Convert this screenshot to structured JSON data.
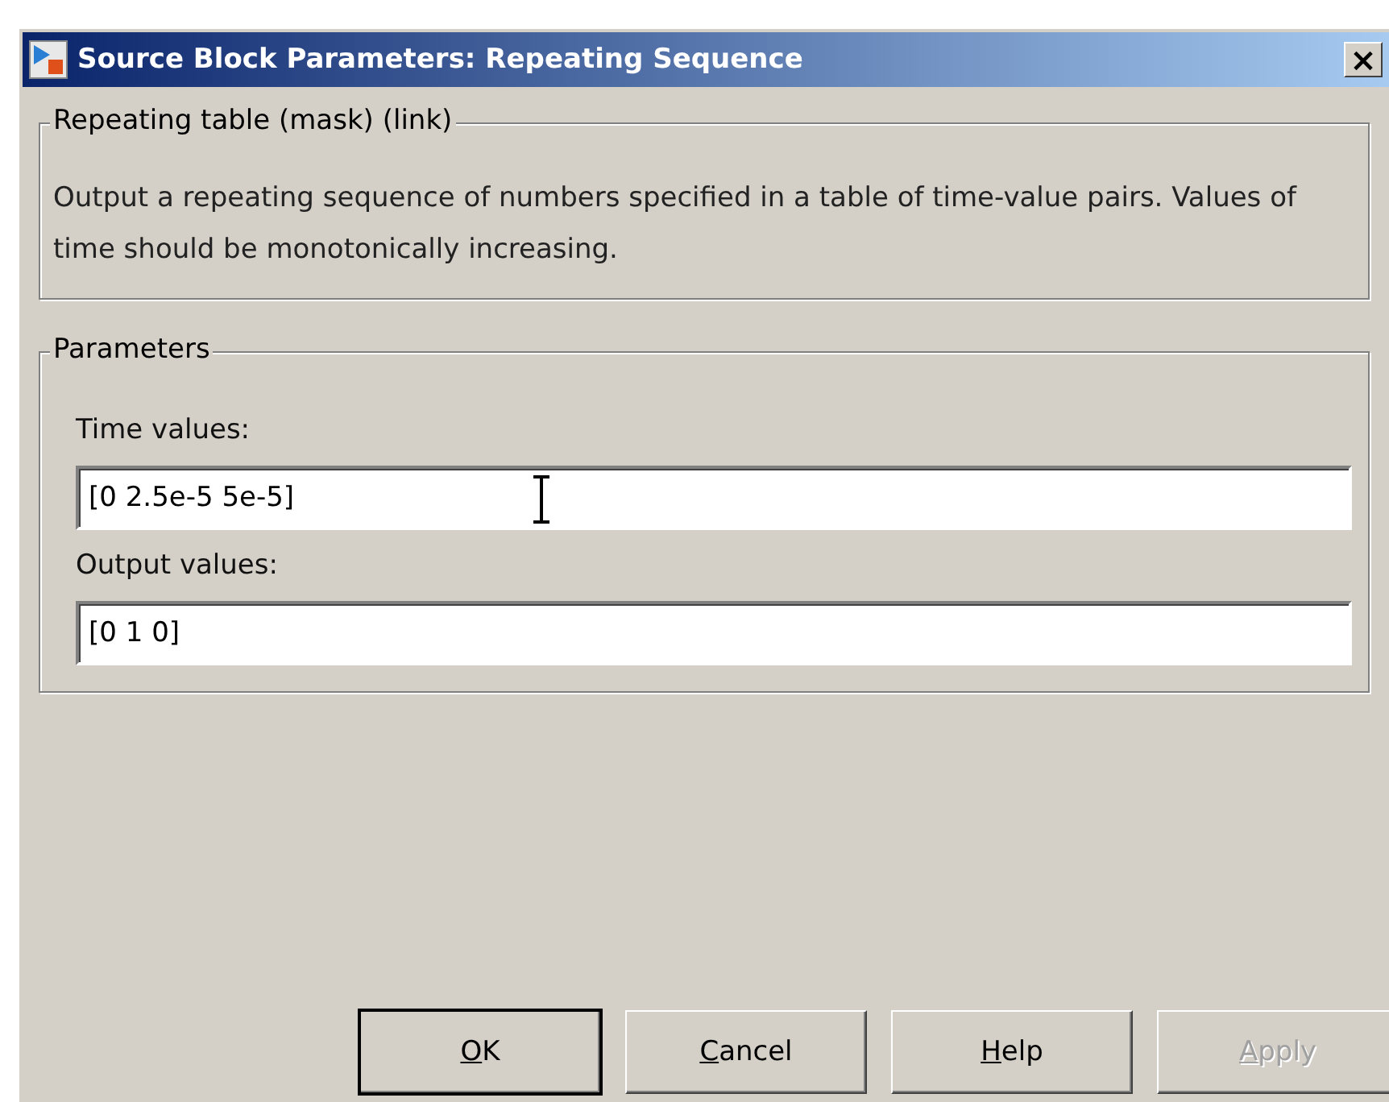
{
  "window": {
    "title": "Source Block Parameters: Repeating Sequence",
    "close": "×"
  },
  "description_group": {
    "title": "Repeating table (mask) (link)",
    "text": "Output a repeating sequence of numbers specified in a table of time-value pairs. Values of time should be monotonically increasing."
  },
  "parameters_group": {
    "title": "Parameters",
    "fields": [
      {
        "label": "Time values:",
        "value": "[0 2.5e-5 5e-5]",
        "mouse_cursor": true
      },
      {
        "label": "Output values:",
        "value": "[0 1 0]",
        "mouse_cursor": false
      }
    ]
  },
  "buttons": [
    {
      "mnemonic": "O",
      "rest": "K",
      "disabled": false,
      "default": true
    },
    {
      "mnemonic": "C",
      "rest": "ancel",
      "disabled": false,
      "default": false
    },
    {
      "mnemonic": "H",
      "rest": "elp",
      "disabled": false,
      "default": false
    },
    {
      "mnemonic": "A",
      "rest": "pply",
      "disabled": true,
      "default": false
    }
  ]
}
